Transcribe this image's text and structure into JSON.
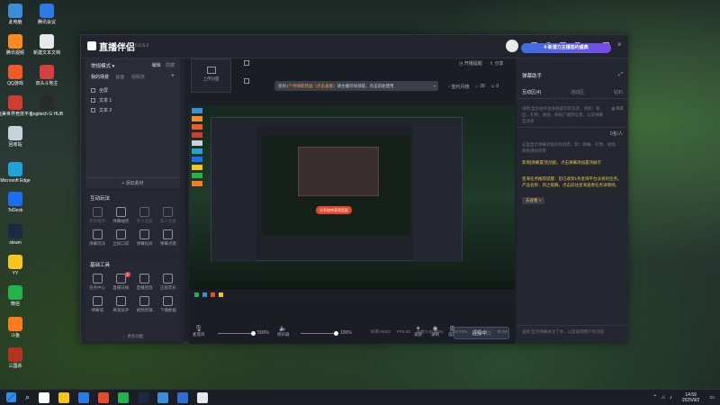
{
  "desktop": {
    "icons": [
      {
        "label": "此电脑",
        "color": "#3a8fd8"
      },
      {
        "label": "腾讯会议",
        "color": "#2b7ae6"
      },
      {
        "label": "腾讯视频",
        "color": "#ff8a1e"
      },
      {
        "label": "新建文本文档",
        "color": "#e6e8ee"
      },
      {
        "label": "QQ游戏",
        "color": "#f05a28"
      },
      {
        "label": "双头斗地主",
        "color": "#d24040"
      },
      {
        "label": "完美世界竞技平台",
        "color": "#d43b2f"
      },
      {
        "label": "Logitech G HUB",
        "color": "#2a2a2a"
      },
      {
        "label": "回收站",
        "color": "#c8d2dc"
      },
      {
        "label": "Microsoft Edge",
        "color": "#1fa3d8"
      },
      {
        "label": "ToDesk",
        "color": "#1a6ff0"
      },
      {
        "label": "steam",
        "color": "#1b2a40"
      },
      {
        "label": "YY",
        "color": "#f5c518"
      },
      {
        "label": "微信",
        "color": "#24b24a"
      },
      {
        "label": "斗鱼",
        "color": "#ff7a1a"
      },
      {
        "label": "三国杀",
        "color": "#b4321f"
      }
    ]
  },
  "app": {
    "title": "直播伴侣",
    "version": "6.6.6.2",
    "header": {
      "upload_label": "上传封面",
      "notice_prefix": "您有",
      "notice_highlight": "1个待领取奖励（点击查看）",
      "notice_suffix": "请主播尽快领取，点击前往使用",
      "open_live_label": "开播提醒",
      "share_label": "分享",
      "reward_label": "签约月榜",
      "count_a": "26",
      "count_b": "0"
    },
    "scene": {
      "mode_label": "常规模式",
      "edit_label": "编辑",
      "hide_label": "隐藏",
      "tabs": [
        "我的场景",
        "画面",
        "视频流"
      ],
      "items": [
        "全屏",
        "文本 1",
        "文本 2"
      ],
      "add_label": "+ 添加素材"
    },
    "interactive": {
      "title": "互动玩法",
      "items": [
        {
          "label": "贵宾推荐",
          "enabled": false
        },
        {
          "label": "弹幕抽奖",
          "enabled": true
        },
        {
          "label": "单人连麦",
          "enabled": false
        },
        {
          "label": "多人连麦",
          "enabled": false
        },
        {
          "label": "弹幕玩法",
          "enabled": true
        },
        {
          "label": "全屏口袋",
          "enabled": true
        },
        {
          "label": "弹幕投屏",
          "enabled": true
        },
        {
          "label": "弹幕点歌",
          "enabled": true
        }
      ]
    },
    "tools": {
      "title": "基础工具",
      "badge": "1",
      "items": [
        "任务中心",
        "直播日报",
        "直播回放",
        "正版音乐",
        "弹幕墙",
        "真爱助手",
        "视频剪辑",
        "下播数据"
      ],
      "more_label": "更多功能"
    },
    "bottom": {
      "mic_label": "麦克风",
      "mic_value": "500%",
      "spk_label": "扬声器",
      "spk_value": "100%",
      "beauty_label": "美颜",
      "record_label": "录制",
      "settings_label": "设置",
      "connect_label": "连接中..."
    },
    "status": {
      "items": [
        "码率:0Kb/s",
        "FPS:30",
        "丢帧:0 (0.00%)",
        "CPU:10%",
        "内存:51%",
        "00:00"
      ]
    },
    "preview": {
      "popup_label": "分享给你获得奖励"
    },
    "danmu": {
      "title": "弹幕助手",
      "tabs": [
        "互动区(4)",
        "活动区",
        "钻石"
      ],
      "hint1": "说明:显示由平台系统提示的信息，例如：粉丝、礼物、进场、系统广播等信息，以及弹幕互动等",
      "count": "0.0",
      "viewer_label": "0名/人",
      "hint2": "这里显示弹幕对观众的消息，如：弹幕、礼物、进场、系统通知等等",
      "msg1": "新增[弹幕置顶]功能，点击弹幕添加置顶展示",
      "msg2": "星海任务推荐提醒：您已收到1条星海平台派发的任务。产品名称：风之痕舞。点击前往星海查看任务详情吧。",
      "msg_link": "去查看 >",
      "hint3": "说明:显示弹幕关注了你，以及送电用户的消息",
      "banner": "4·新潜力主播签约盛典"
    }
  },
  "taskbar": {
    "time": "14:59",
    "date": "2025/9/2",
    "apps": [
      "#ffffff",
      "#f5c518",
      "#2b7ae6",
      "#e84a2f",
      "#24b24a",
      "#1b2a40",
      "#3a8fd8",
      "#2d6fd0",
      "#e6e8ee"
    ]
  }
}
